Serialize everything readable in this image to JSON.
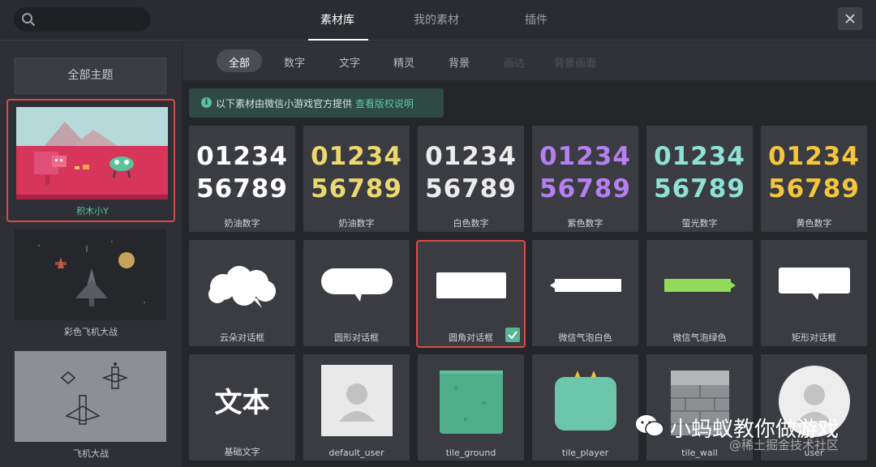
{
  "header": {
    "search": {
      "placeholder": ""
    },
    "tabs": [
      {
        "label": "素材库",
        "active": true
      },
      {
        "label": "我的素材",
        "active": false
      },
      {
        "label": "插件",
        "active": false
      }
    ]
  },
  "sidebar": {
    "all_label": "全部主题",
    "themes": [
      {
        "label": "积木小Y",
        "selected": true
      },
      {
        "label": "彩色飞机大战",
        "selected": false
      },
      {
        "label": "飞机大战",
        "selected": false
      }
    ]
  },
  "filters": {
    "items": [
      {
        "label": "全部",
        "active": true
      },
      {
        "label": "数字"
      },
      {
        "label": "文字"
      },
      {
        "label": "精灵"
      },
      {
        "label": "背景"
      },
      {
        "label": "画达"
      },
      {
        "label": "背景画面"
      }
    ]
  },
  "notice": {
    "text": "以下素材由微信小游戏官方提供",
    "link": "查看版权说明"
  },
  "grid": {
    "row1": [
      {
        "label": "奶油数字",
        "digits_top": "01234",
        "digits_bottom": "56789"
      },
      {
        "label": "奶油数字",
        "digits_top": "01234",
        "digits_bottom": "56789"
      },
      {
        "label": "白色数字",
        "digits_top": "01234",
        "digits_bottom": "56789"
      },
      {
        "label": "紫色数字",
        "digits_top": "01234",
        "digits_bottom": "56789"
      },
      {
        "label": "萤光数字",
        "digits_top": "01234",
        "digits_bottom": "56789"
      },
      {
        "label": "黄色数字",
        "digits_top": "01234",
        "digits_bottom": "56789"
      }
    ],
    "row2": [
      {
        "label": "云朵对话框"
      },
      {
        "label": "圆形对话框"
      },
      {
        "label": "圆角对话框",
        "selected": true
      },
      {
        "label": "微信气泡白色"
      },
      {
        "label": "微信气泡绿色"
      },
      {
        "label": "矩形对话框"
      }
    ],
    "row3": [
      {
        "label": "基础文字",
        "sample": "文本"
      },
      {
        "label": "default_user"
      },
      {
        "label": "tile_ground"
      },
      {
        "label": "tile_player"
      },
      {
        "label": "tile_wall"
      },
      {
        "label": "user"
      }
    ]
  },
  "watermark": {
    "main": "小蚂蚁教你做游戏",
    "sub": "@稀土掘金技术社区"
  },
  "colors": {
    "accent_green": "#57b694",
    "selection_red": "#d94a48"
  }
}
